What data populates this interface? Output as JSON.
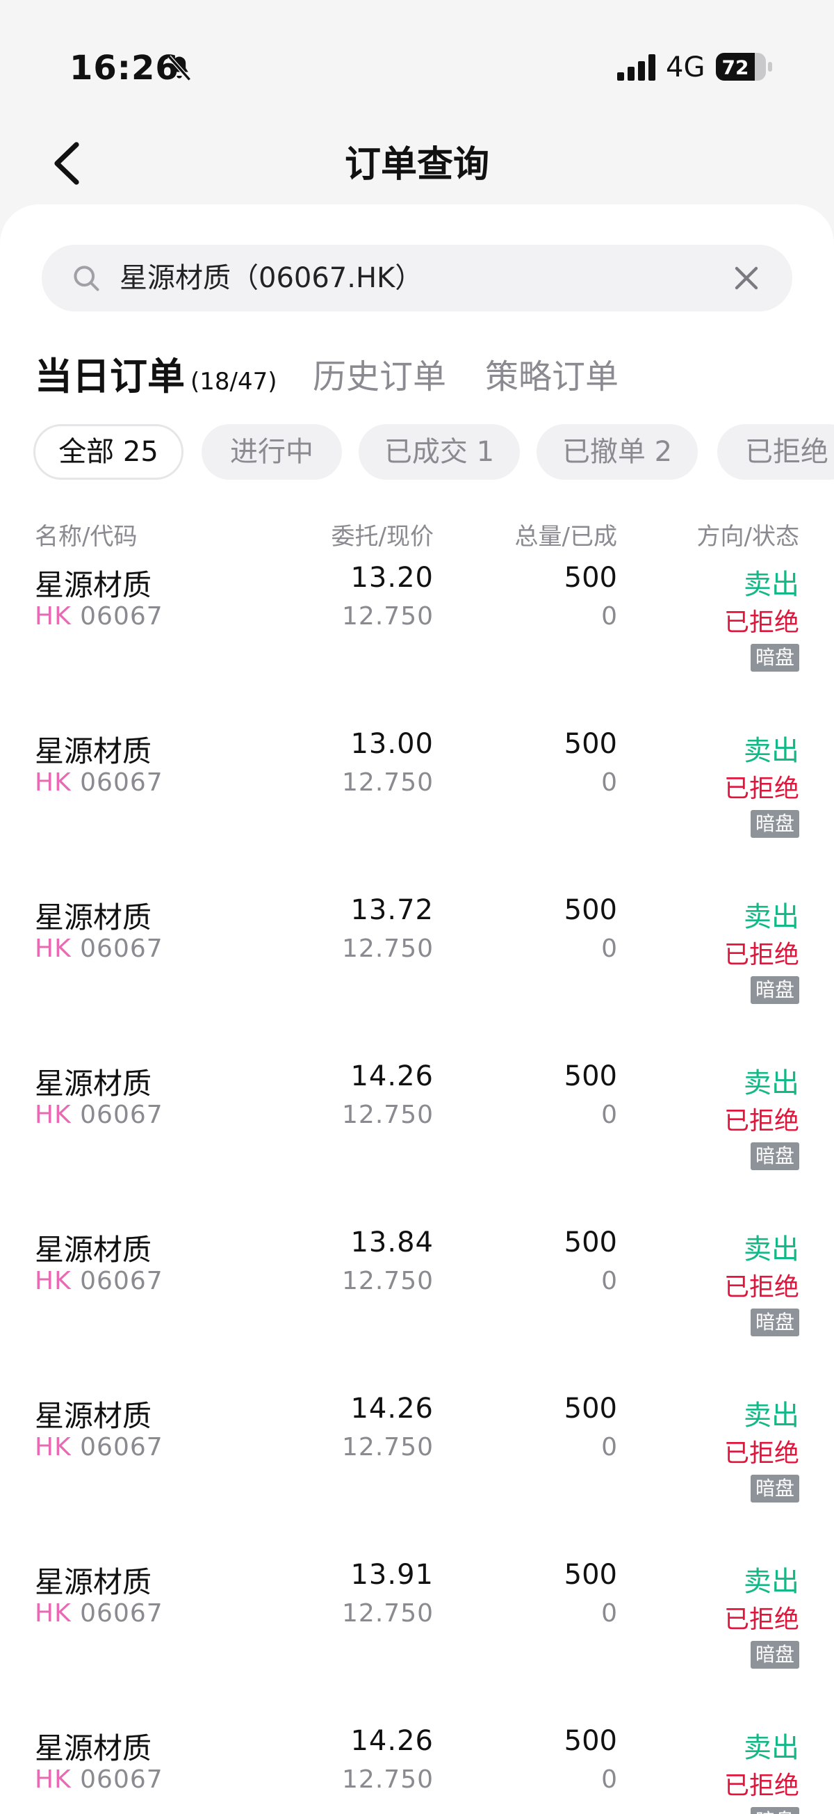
{
  "status_bar": {
    "time": "16:26",
    "network": "4G",
    "battery": "72"
  },
  "header": {
    "title": "订单查询"
  },
  "search": {
    "value": "星源材质（06067.HK）"
  },
  "tabs": [
    {
      "label": "当日订单",
      "count": "(18/47)"
    },
    {
      "label": "历史订单"
    },
    {
      "label": "策略订单"
    }
  ],
  "filters": [
    {
      "label": "全部 25"
    },
    {
      "label": "进行中"
    },
    {
      "label": "已成交 1"
    },
    {
      "label": "已撤单 2"
    },
    {
      "label": "已拒绝"
    }
  ],
  "columns": {
    "name_code": "名称/代码",
    "price": "委托/现价",
    "qty": "总量/已成",
    "dir_status": "方向/状态"
  },
  "orders": [
    {
      "name": "星源材质",
      "market": "HK",
      "code": "06067",
      "price": "13.20",
      "current": "12.750",
      "qty": "500",
      "filled": "0",
      "direction": "卖出",
      "status": "已拒绝",
      "badge": "暗盘"
    },
    {
      "name": "星源材质",
      "market": "HK",
      "code": "06067",
      "price": "13.00",
      "current": "12.750",
      "qty": "500",
      "filled": "0",
      "direction": "卖出",
      "status": "已拒绝",
      "badge": "暗盘"
    },
    {
      "name": "星源材质",
      "market": "HK",
      "code": "06067",
      "price": "13.72",
      "current": "12.750",
      "qty": "500",
      "filled": "0",
      "direction": "卖出",
      "status": "已拒绝",
      "badge": "暗盘"
    },
    {
      "name": "星源材质",
      "market": "HK",
      "code": "06067",
      "price": "14.26",
      "current": "12.750",
      "qty": "500",
      "filled": "0",
      "direction": "卖出",
      "status": "已拒绝",
      "badge": "暗盘"
    },
    {
      "name": "星源材质",
      "market": "HK",
      "code": "06067",
      "price": "13.84",
      "current": "12.750",
      "qty": "500",
      "filled": "0",
      "direction": "卖出",
      "status": "已拒绝",
      "badge": "暗盘"
    },
    {
      "name": "星源材质",
      "market": "HK",
      "code": "06067",
      "price": "14.26",
      "current": "12.750",
      "qty": "500",
      "filled": "0",
      "direction": "卖出",
      "status": "已拒绝",
      "badge": "暗盘"
    },
    {
      "name": "星源材质",
      "market": "HK",
      "code": "06067",
      "price": "13.91",
      "current": "12.750",
      "qty": "500",
      "filled": "0",
      "direction": "卖出",
      "status": "已拒绝",
      "badge": "暗盘"
    },
    {
      "name": "星源材质",
      "market": "HK",
      "code": "06067",
      "price": "14.26",
      "current": "12.750",
      "qty": "500",
      "filled": "0",
      "direction": "卖出",
      "status": "已拒绝",
      "badge": "暗盘"
    }
  ],
  "colors": {
    "sell": "#12b886",
    "rejected": "#e0153b",
    "market": "#e76ab2"
  }
}
